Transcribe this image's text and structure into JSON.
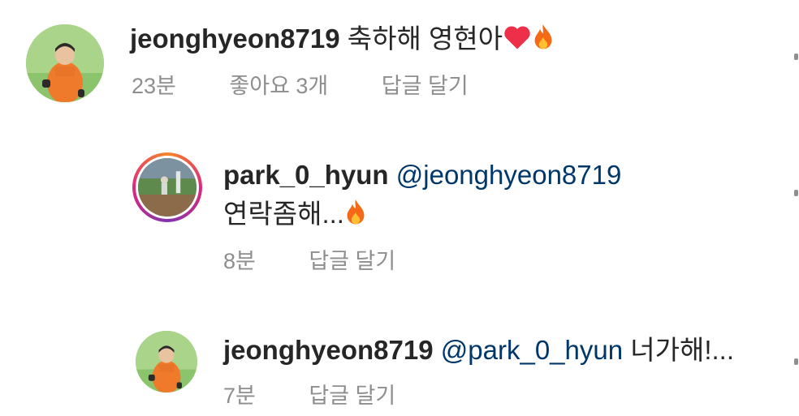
{
  "comments": [
    {
      "username": "jeonghyeon8719",
      "mention": "",
      "text": "축하해 영현아",
      "time": "23분",
      "likes": "좋아요 3개",
      "reply": "답글 달기"
    },
    {
      "username": "park_0_hyun",
      "mention": "@jeonghyeon8719",
      "text": "연락좀해...",
      "time": "8분",
      "reply": "답글 달기"
    },
    {
      "username": "jeonghyeon8719",
      "mention": "@park_0_hyun",
      "text": "너가해!...",
      "time": "7분",
      "reply": "답글 달기"
    }
  ],
  "icons": {
    "heart": "heart-icon",
    "fire": "fire-icon"
  },
  "colors": {
    "username": "#262626",
    "mention": "#00376b",
    "meta": "#8e8e8e",
    "heart": "#ed2f49",
    "fire": "#f46a16"
  }
}
